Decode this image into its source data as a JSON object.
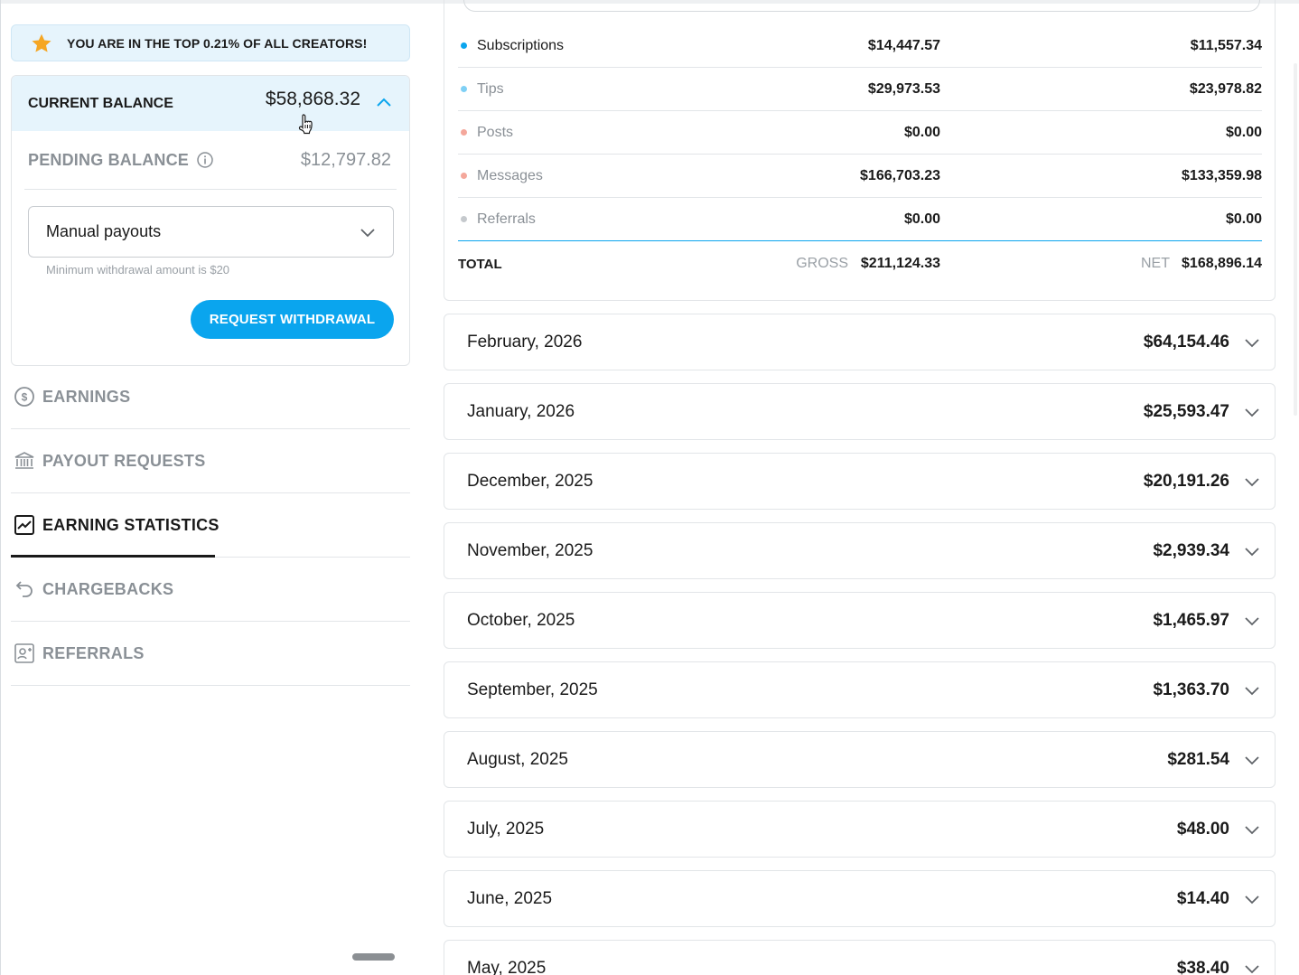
{
  "banner": {
    "text": "YOU ARE IN THE TOP 0.21% OF ALL CREATORS!",
    "icon": "star-icon",
    "star_color": "#f5a623"
  },
  "balance": {
    "current_label": "CURRENT BALANCE",
    "current_amount": "$58,868.32",
    "pending_label": "PENDING BALANCE",
    "pending_amount": "$12,797.82",
    "payout_mode": "Manual payouts",
    "min_hint": "Minimum withdrawal amount is $20",
    "withdraw_label": "REQUEST WITHDRAWAL"
  },
  "nav": [
    {
      "label": "EARNINGS",
      "icon": "dollar-circle-icon"
    },
    {
      "label": "PAYOUT REQUESTS",
      "icon": "bank-icon"
    },
    {
      "label": "EARNING STATISTICS",
      "icon": "chart-icon",
      "active": true
    },
    {
      "label": "CHARGEBACKS",
      "icon": "undo-icon"
    },
    {
      "label": "REFERRALS",
      "icon": "referral-icon"
    }
  ],
  "summary": {
    "rows": [
      {
        "name": "Subscriptions",
        "gross": "$14,447.57",
        "net": "$11,557.34",
        "color": "#0aa5ee"
      },
      {
        "name": "Tips",
        "gross": "$29,973.53",
        "net": "$23,978.82",
        "color": "#7fd0f5"
      },
      {
        "name": "Posts",
        "gross": "$0.00",
        "net": "$0.00",
        "color": "#f4a79b"
      },
      {
        "name": "Messages",
        "gross": "$166,703.23",
        "net": "$133,359.98",
        "color": "#f4a79b"
      },
      {
        "name": "Referrals",
        "gross": "$0.00",
        "net": "$0.00",
        "color": "#c5c9cd"
      }
    ],
    "total_label": "TOTAL",
    "gross_label": "GROSS",
    "total_gross": "$211,124.33",
    "net_label": "NET",
    "total_net": "$168,896.14"
  },
  "months": [
    {
      "label": "February, 2026",
      "amount": "$64,154.46"
    },
    {
      "label": "January, 2026",
      "amount": "$25,593.47"
    },
    {
      "label": "December, 2025",
      "amount": "$20,191.26"
    },
    {
      "label": "November, 2025",
      "amount": "$2,939.34"
    },
    {
      "label": "October, 2025",
      "amount": "$1,465.97"
    },
    {
      "label": "September, 2025",
      "amount": "$1,363.70"
    },
    {
      "label": "August, 2025",
      "amount": "$281.54"
    },
    {
      "label": "July, 2025",
      "amount": "$48.00"
    },
    {
      "label": "June, 2025",
      "amount": "$14.40"
    },
    {
      "label": "May, 2025",
      "amount": "$38.40"
    }
  ],
  "colors": {
    "accent": "#0aa5ee",
    "banner_bg": "#e6f4fc",
    "muted": "#8a9096"
  }
}
